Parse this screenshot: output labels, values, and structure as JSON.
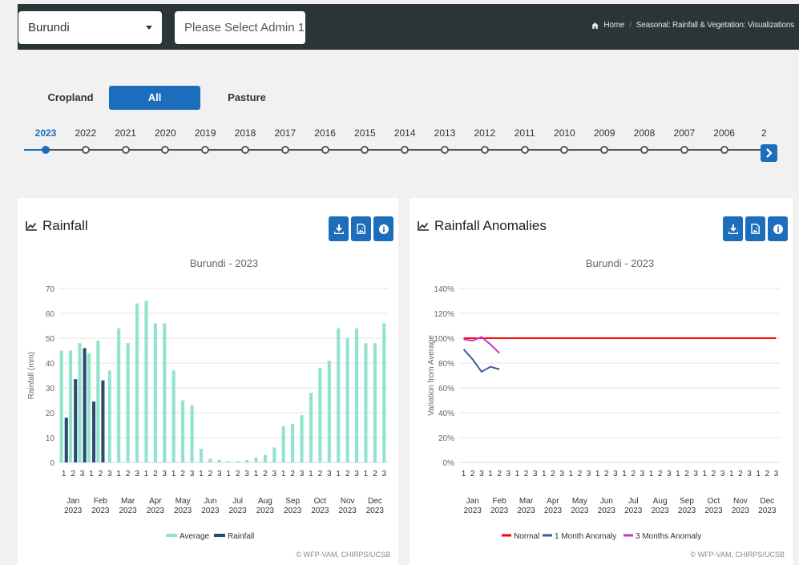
{
  "header": {
    "country_select": "Burundi",
    "admin_select_placeholder": "Please Select Admin 1",
    "breadcrumb": {
      "home": "Home",
      "current": "Seasonal: Rainfall & Vegetation: Visualizations"
    }
  },
  "filters": {
    "cropland": "Cropland",
    "all": "All",
    "pasture": "Pasture",
    "selected": "All"
  },
  "timeline": {
    "years": [
      "2023",
      "2022",
      "2021",
      "2020",
      "2019",
      "2018",
      "2017",
      "2016",
      "2015",
      "2014",
      "2013",
      "2012",
      "2011",
      "2010",
      "2009",
      "2008",
      "2007",
      "2006",
      "2"
    ],
    "selected": "2023"
  },
  "colors": {
    "primary": "#1d6dbd",
    "average": "#90e3cf",
    "rainfall": "#2b4b6c",
    "normal": "#ff0000",
    "anomaly_1m": "#3c5a99",
    "anomaly_3m": "#cc33cc"
  },
  "panels": {
    "rainfall": {
      "title": "Rainfall",
      "icons": [
        "download-icon",
        "image-icon",
        "info-icon"
      ],
      "credits": "© WFP-VAM, CHIRPS/UCSB"
    },
    "anomalies": {
      "title": "Rainfall Anomalies",
      "icons": [
        "download-icon",
        "image-icon",
        "info-icon"
      ],
      "credits": "© WFP-VAM, CHIRPS/UCSB"
    }
  },
  "chart_data": [
    {
      "type": "bar",
      "title": "Burundi - 2023",
      "xlabel": "",
      "ylabel": "Rainfall (mm)",
      "ylim": [
        0,
        70
      ],
      "yticks": [
        0,
        10,
        20,
        30,
        40,
        50,
        60,
        70
      ],
      "dekads": [
        "1",
        "2",
        "3"
      ],
      "months": [
        "Jan\n2023",
        "Feb\n2023",
        "Mar\n2023",
        "Apr\n2023",
        "May\n2023",
        "Jun\n2023",
        "Jul\n2023",
        "Aug\n2023",
        "Sep\n2023",
        "Oct\n2023",
        "Nov\n2023",
        "Dec\n2023"
      ],
      "series": [
        {
          "name": "Average",
          "values": [
            45,
            45,
            48,
            44,
            49,
            37,
            54,
            48,
            64,
            65,
            56,
            56,
            37,
            25,
            23,
            5.5,
            1.5,
            1,
            0.5,
            0.5,
            1,
            2,
            3,
            6,
            14.5,
            15.5,
            19,
            28,
            38,
            41,
            54,
            50,
            54,
            48,
            48,
            56
          ]
        },
        {
          "name": "Rainfall",
          "values": [
            18,
            33.5,
            46,
            24.5,
            33
          ]
        }
      ],
      "legend": "bottom"
    },
    {
      "type": "line",
      "title": "Burundi - 2023",
      "xlabel": "",
      "ylabel": "Variation from Average",
      "ylim": [
        0,
        140
      ],
      "yticks": [
        "0%",
        "20%",
        "40%",
        "60%",
        "80%",
        "100%",
        "120%",
        "140%"
      ],
      "dekads": [
        "1",
        "2",
        "3"
      ],
      "months": [
        "Jan\n2023",
        "Feb\n2023",
        "Mar\n2023",
        "Apr\n2023",
        "May\n2023",
        "Jun\n2023",
        "Jul\n2023",
        "Aug\n2023",
        "Sep\n2023",
        "Oct\n2023",
        "Nov\n2023",
        "Dec\n2023"
      ],
      "series": [
        {
          "name": "Normal",
          "values": [
            100,
            100,
            100,
            100,
            100,
            100,
            100,
            100,
            100,
            100,
            100,
            100,
            100,
            100,
            100,
            100,
            100,
            100,
            100,
            100,
            100,
            100,
            100,
            100,
            100,
            100,
            100,
            100,
            100,
            100,
            100,
            100,
            100,
            100,
            100,
            100
          ]
        },
        {
          "name": "1 Month Anomaly",
          "values": [
            91,
            83,
            73,
            77,
            75
          ]
        },
        {
          "name": "3 Months Anomaly",
          "values": [
            99,
            98,
            101,
            95,
            88
          ]
        }
      ],
      "legend": "bottom"
    }
  ]
}
